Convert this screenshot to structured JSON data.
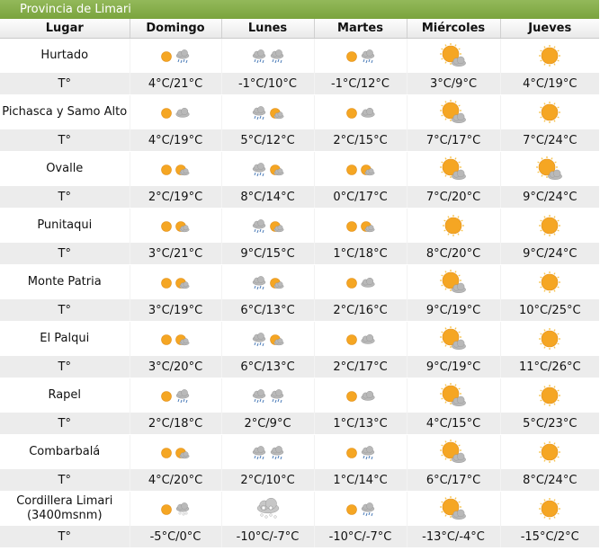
{
  "title": "Provincia de Limari",
  "headers": [
    "Lugar",
    "Domingo",
    "Lunes",
    "Martes",
    "Miércoles",
    "Jueves"
  ],
  "temp_label": "T°",
  "rows": [
    {
      "place": "Hurtado",
      "icons": [
        "sun-rain",
        "cloud-rain-double",
        "sun-rain",
        "big-sun-cloud",
        "big-sun"
      ],
      "temps": [
        "4°C/21°C",
        "-1°C/10°C",
        "-1°C/12°C",
        "3°C/9°C",
        "4°C/19°C"
      ]
    },
    {
      "place": "Pichasca y Samo Alto",
      "icons": [
        "sun-cloud",
        "cloud-rain-sun",
        "sun-cloud",
        "big-sun-cloud",
        "big-sun"
      ],
      "temps": [
        "4°C/19°C",
        "5°C/12°C",
        "2°C/15°C",
        "7°C/17°C",
        "7°C/24°C"
      ]
    },
    {
      "place": "Ovalle",
      "icons": [
        "sun-partly",
        "cloud-rain-sun",
        "sun-partly",
        "big-sun-cloud",
        "big-sun-cloud"
      ],
      "temps": [
        "2°C/19°C",
        "8°C/14°C",
        "0°C/17°C",
        "7°C/20°C",
        "9°C/24°C"
      ]
    },
    {
      "place": "Punitaqui",
      "icons": [
        "sun-partly",
        "cloud-rain-sun",
        "sun-partly",
        "big-sun",
        "big-sun"
      ],
      "temps": [
        "3°C/21°C",
        "9°C/15°C",
        "1°C/18°C",
        "8°C/20°C",
        "9°C/24°C"
      ]
    },
    {
      "place": "Monte Patria",
      "icons": [
        "sun-partly",
        "cloud-rain-sun",
        "sun-cloud",
        "big-sun-cloud",
        "big-sun"
      ],
      "temps": [
        "3°C/19°C",
        "6°C/13°C",
        "2°C/16°C",
        "9°C/19°C",
        "10°C/25°C"
      ]
    },
    {
      "place": "El Palqui",
      "icons": [
        "sun-partly",
        "cloud-rain-sun",
        "sun-cloud",
        "big-sun-cloud",
        "big-sun"
      ],
      "temps": [
        "3°C/20°C",
        "6°C/13°C",
        "2°C/17°C",
        "9°C/19°C",
        "11°C/26°C"
      ]
    },
    {
      "place": "Rapel",
      "icons": [
        "sun-rain",
        "cloud-rain-double",
        "sun-cloud",
        "big-sun-cloud",
        "big-sun"
      ],
      "temps": [
        "2°C/18°C",
        "2°C/9°C",
        "1°C/13°C",
        "4°C/15°C",
        "5°C/23°C"
      ]
    },
    {
      "place": "Combarbalá",
      "icons": [
        "sun-partly",
        "cloud-rain-double",
        "sun-rain",
        "big-sun-cloud",
        "big-sun"
      ],
      "temps": [
        "4°C/20°C",
        "2°C/10°C",
        "1°C/14°C",
        "6°C/17°C",
        "8°C/24°C"
      ]
    },
    {
      "place": "Cordillera Limari (3400msnm)",
      "icons": [
        "sun-snow",
        "big-snow-cloud",
        "sun-rain",
        "big-sun-cloud",
        "big-sun"
      ],
      "temps": [
        "-5°C/0°C",
        "-10°C/-7°C",
        "-10°C/-7°C",
        "-13°C/-4°C",
        "-15°C/2°C"
      ]
    }
  ],
  "colors": {
    "banner": "#7aa43d",
    "sun": "#f5a623",
    "cloud": "#b9b9b9",
    "rain": "#4a7ab8",
    "temp_row": "#ececec"
  }
}
